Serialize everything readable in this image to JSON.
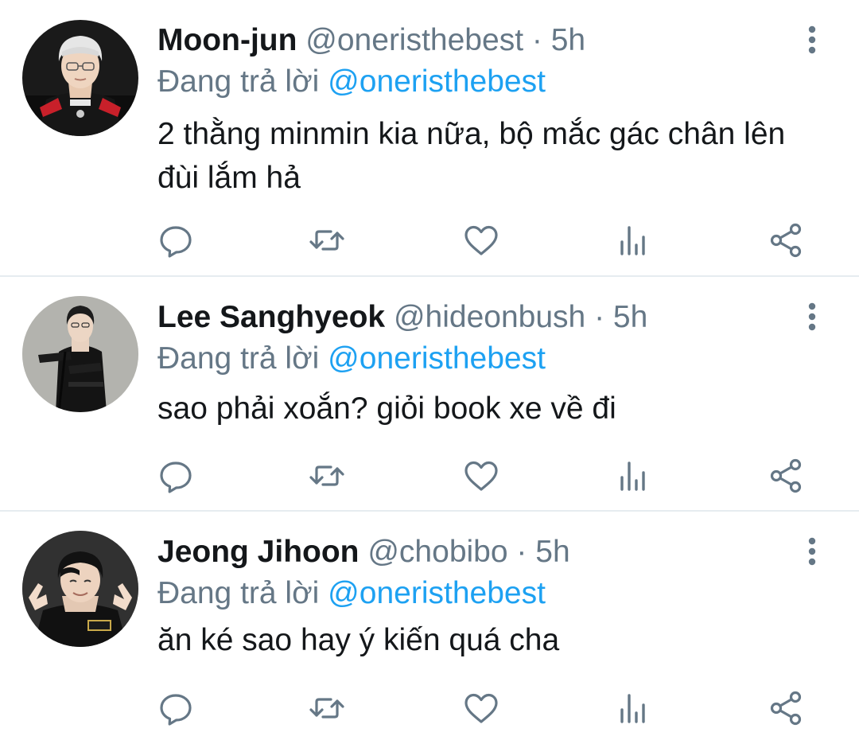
{
  "colors": {
    "name": "#14171a",
    "secondary": "#657786",
    "link": "#1da1f2",
    "divider": "#e6ecf0",
    "icon": "#657786"
  },
  "reply_prefix": "Đang trả lời",
  "icons": [
    "reply-icon",
    "retweet-icon",
    "like-icon",
    "analytics-icon",
    "share-icon",
    "more-vertical-icon"
  ],
  "tweets": [
    {
      "name": "Moon-jun",
      "handle": "@oneristhebest",
      "separator": "·",
      "time": "5h",
      "reply_to": "@oneristhebest",
      "text": "2 thằng minmin kia nữa, bộ mắc gác chân lên đùi lắm hả"
    },
    {
      "name": "Lee Sanghyeok",
      "handle": "@hideonbush",
      "separator": "·",
      "time": "5h",
      "reply_to": "@oneristhebest",
      "text": "sao phải xoắn? giỏi book xe về đi"
    },
    {
      "name": "Jeong Jihoon",
      "handle": "@chobibo",
      "separator": "·",
      "time": "5h",
      "reply_to": "@oneristhebest",
      "text": "ăn ké sao hay ý kiến quá cha"
    }
  ]
}
